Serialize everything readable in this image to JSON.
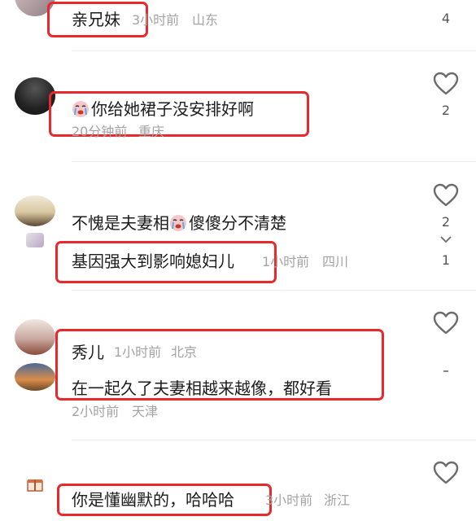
{
  "comments": [
    {
      "text": "亲兄妹",
      "time": "3小时前",
      "location": "山东",
      "likes": "4"
    },
    {
      "text": "你给她裙子没安排好啊",
      "time": "20分钟前",
      "location": "重庆",
      "likes": "2"
    },
    {
      "text": "不愧是夫妻相",
      "text2": "傻傻分不清楚",
      "likes": "2",
      "reply": {
        "text": "基因强大到影响媳妇儿",
        "time": "1小时前",
        "location": "四川",
        "likes": "1"
      }
    },
    {
      "name": "秀儿",
      "time": "1小时前",
      "location": "北京",
      "reply": {
        "text": "在一起久了夫妻相越来越像，都好看",
        "time": "2小时前",
        "location": "天津"
      }
    },
    {
      "text": "你是懂幽默的，哈哈哈",
      "time": "3小时前",
      "location": "浙江"
    }
  ],
  "colors": {
    "highlight": "#e8282a",
    "meta": "#a3a3a3",
    "heart": "#6b6b6b"
  },
  "icons": [
    "heart-icon",
    "crying-emoji-icon",
    "chevron-down-icon",
    "gift-icon"
  ]
}
